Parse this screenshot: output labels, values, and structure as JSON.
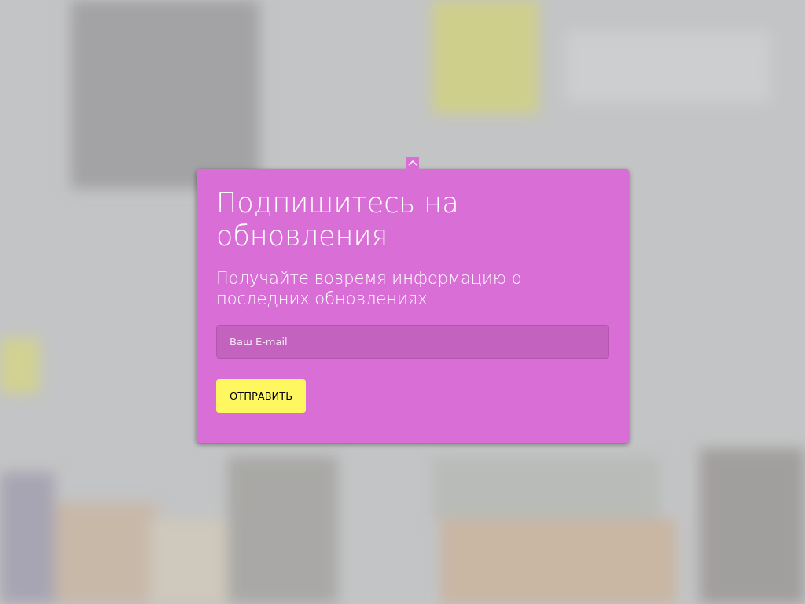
{
  "popup": {
    "title": "Подпишитесь на обновления",
    "subtitle": "Получайте вовремя информацию о последних обновлениях",
    "email_field": {
      "placeholder": "Ваш E-mail"
    },
    "submit_button": "ОТПРАВИТЬ"
  }
}
